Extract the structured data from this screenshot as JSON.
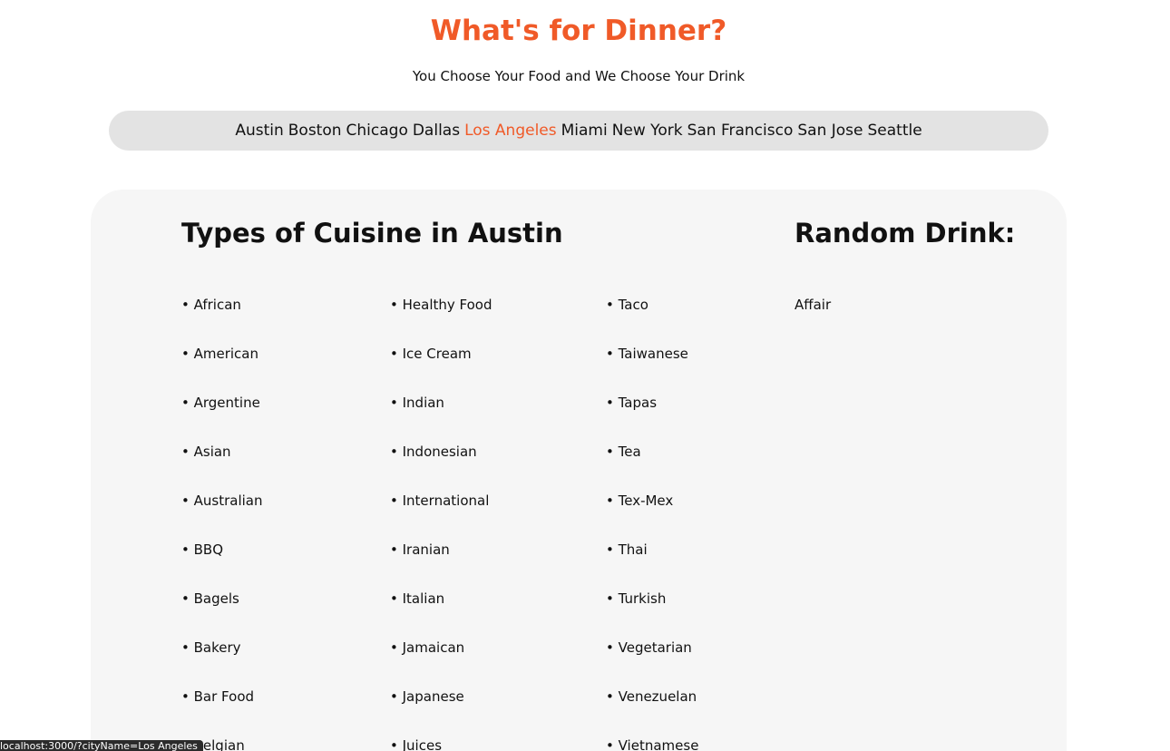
{
  "header": {
    "title": "What's for Dinner?",
    "subtitle": "You Choose Your Food and We Choose Your Drink"
  },
  "cities": {
    "items": [
      "Austin",
      "Boston",
      "Chicago",
      "Dallas",
      "Los Angeles",
      "Miami",
      "New York",
      "San Francisco",
      "San Jose",
      "Seattle"
    ],
    "hovered": "Los Angeles"
  },
  "cuisine": {
    "heading": "Types of Cuisine in Austin",
    "columns": [
      [
        "African",
        "American",
        "Argentine",
        "Asian",
        "Australian",
        "BBQ",
        "Bagels",
        "Bakery",
        "Bar Food",
        "Belgian"
      ],
      [
        "Healthy Food",
        "Ice Cream",
        "Indian",
        "Indonesian",
        "International",
        "Iranian",
        "Italian",
        "Jamaican",
        "Japanese",
        "Juices"
      ],
      [
        "Taco",
        "Taiwanese",
        "Tapas",
        "Tea",
        "Tex-Mex",
        "Thai",
        "Turkish",
        "Vegetarian",
        "Venezuelan",
        "Vietnamese"
      ]
    ]
  },
  "drink": {
    "heading": "Random Drink:",
    "name": "Affair"
  },
  "status_bar": {
    "url": "localhost:3000/?cityName=Los Angeles"
  },
  "colors": {
    "accent": "#f05a28",
    "city_bar": "#e3e3e3",
    "panel": "#f6f6f6"
  }
}
